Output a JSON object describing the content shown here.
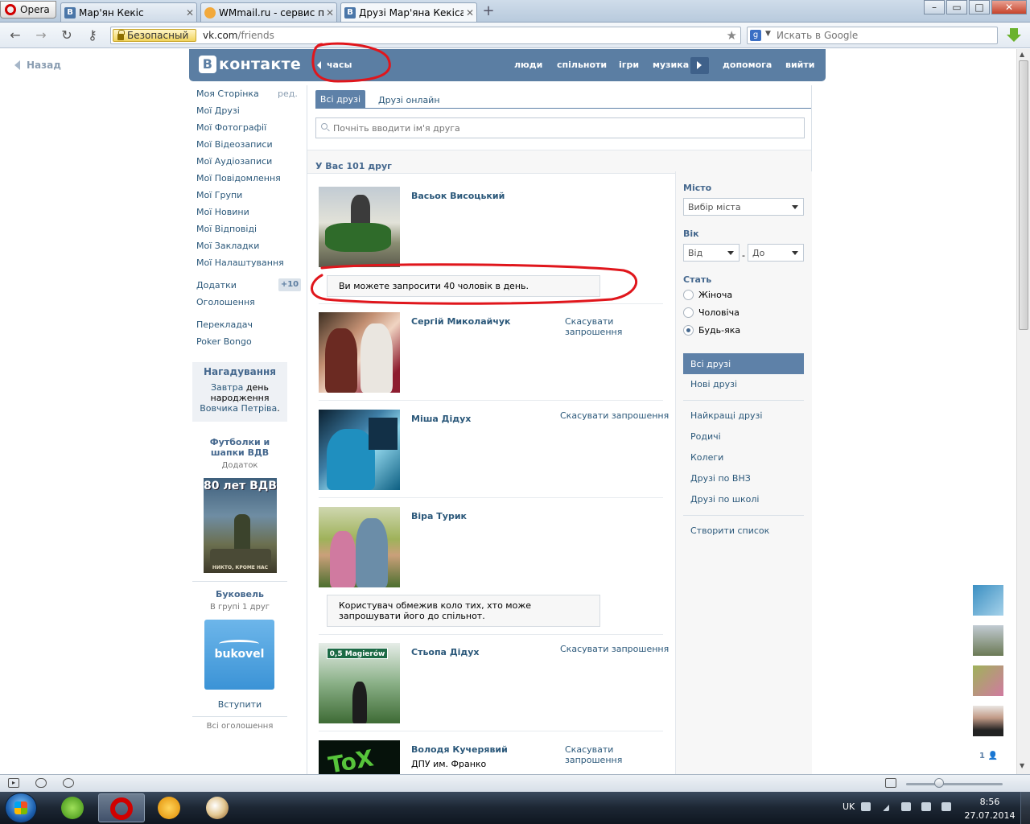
{
  "browser": {
    "menu_label": "Opera",
    "tabs": [
      {
        "title": "Мар'ян Кекіс",
        "icon": "vk-favicon"
      },
      {
        "title": "WMmail.ru - сервис п...",
        "icon": "wmmail-favicon"
      },
      {
        "title": "Друзі Мар'яна Кекіса |...",
        "icon": "vk-favicon"
      }
    ],
    "security_label": "Безопасный",
    "url_host": "vk.com",
    "url_path": "/friends",
    "search_placeholder": "Искать в Google"
  },
  "page": {
    "back_label": "Назад",
    "header": {
      "logo_text": "контакте",
      "logo_letter": "В",
      "status": "часы",
      "nav": [
        "люди",
        "спільноти",
        "ігри",
        "музика",
        "допомога",
        "вийти"
      ]
    },
    "left_menu": {
      "items": [
        "Моя Сторінка",
        "Мої Друзі",
        "Мої Фотографії",
        "Мої Відеозаписи",
        "Мої Аудіозаписи",
        "Мої Повідомлення",
        "Мої Групи",
        "Мої Новини",
        "Мої Відповіді",
        "Мої Закладки",
        "Мої Налаштування"
      ],
      "edit_label": "ред.",
      "apps_label": "Додатки",
      "apps_badge": "+10",
      "ads_label": "Оголошення",
      "extra_items": [
        "Перекладач",
        "Poker Bongo"
      ]
    },
    "reminder": {
      "title": "Нагадування",
      "when": "Завтра",
      "text_before": "день народження",
      "person": "Вовчика Петріва",
      "period": "."
    },
    "ads": [
      {
        "title": "Футболки и шапки ВДВ",
        "subtitle": "Додаток",
        "image_caption": "80 лет ВДВ",
        "banner_text": "НИКТО, КРОМЕ НАС"
      },
      {
        "title": "Буковель",
        "subtitle": "В групі 1 друг",
        "image_caption": "bukovel",
        "action": "Вступити"
      }
    ],
    "all_ads_label": "Всі оголошення",
    "tabs": {
      "all": "Всі друзі",
      "online": "Друзі онлайн"
    },
    "search_placeholder": "Почніть вводити ім'я друга",
    "friend_count": "У Вас 101 друг",
    "friends": [
      {
        "name": "Васьок Висоцький",
        "action": "",
        "sub": ""
      },
      {
        "name": "Сергій Миколайчук",
        "action": "Скасувати запрошення",
        "sub": ""
      },
      {
        "name": "Міша Дідух",
        "action": "Скасувати запрошення",
        "sub": ""
      },
      {
        "name": "Віра Турик",
        "action": "",
        "sub": ""
      },
      {
        "name": "Стьопа Дідух",
        "action": "Скасувати запрошення",
        "sub": ""
      },
      {
        "name": "Володя Кучерявий",
        "action": "Скасувати запрошення",
        "sub": "ДПУ им. Франко"
      }
    ],
    "notices": {
      "invite_limit": "Ви можете запросити 40 чоловік в день.",
      "group_restricted": "Користувач обмежив коло тих, хто може запрошувати його до спільнот."
    },
    "photo_sign": "0,5 Magierów",
    "filters": {
      "city_label": "Місто",
      "city_value": "Вибір міста",
      "age_label": "Вік",
      "age_from": "Від",
      "age_dash": "-",
      "age_to": "До",
      "sex_label": "Стать",
      "sex_options": [
        "Жіноча",
        "Чоловіча",
        "Будь-яка"
      ],
      "sex_selected": 2,
      "lists_primary": [
        "Всі друзі",
        "Нові друзі"
      ],
      "lists_secondary": [
        "Найкращі друзі",
        "Родичі",
        "Колеги",
        "Друзі по ВНЗ",
        "Друзі по школі"
      ],
      "create_list": "Створити список"
    },
    "chat_count": "1"
  },
  "taskbar": {
    "language": "UK",
    "time": "8:56",
    "date": "27.07.2014"
  },
  "colors": {
    "vk_blue": "#5b7ea3",
    "link": "#2b587a",
    "annotation": "#e0161c"
  }
}
